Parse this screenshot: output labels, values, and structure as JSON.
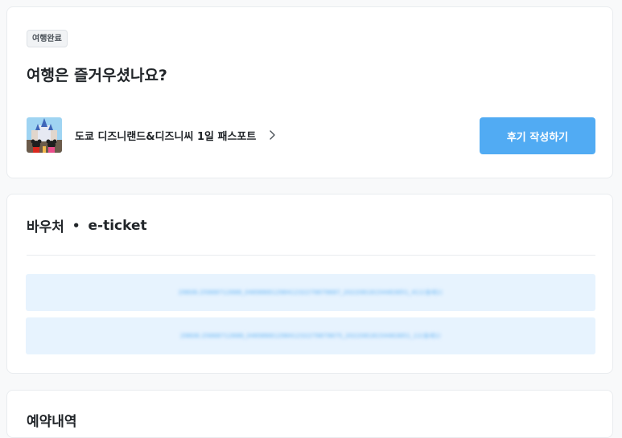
{
  "trip": {
    "badge": "여행완료",
    "title": "여행은 즐거우셨나요?",
    "product_name": "도쿄 디즈니랜드&디즈니씨 1일 패스포트",
    "review_button": "후기 작성하기"
  },
  "voucher": {
    "title": "바우처",
    "separator": "•",
    "subtitle": "e-ticket",
    "tickets": [
      "29606.25668712688_0469868129841232279879687_20220618154463851_411(용세1)",
      "29606.25668712688_0469868129841232279879675_20220618154463851_11(용세1)"
    ]
  },
  "booking": {
    "title": "예약내역"
  },
  "colors": {
    "accent": "#51abf3",
    "ticket_bg": "#e7f3fe"
  }
}
